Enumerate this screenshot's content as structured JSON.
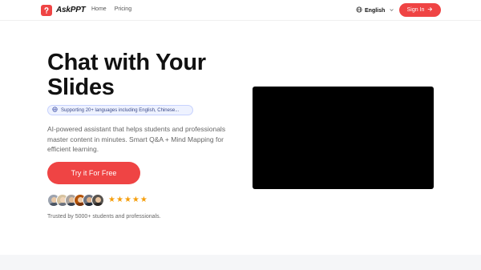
{
  "header": {
    "brand": "AskPPT",
    "nav": [
      {
        "label": "Home"
      },
      {
        "label": "Pricing"
      }
    ],
    "language": "English",
    "signin_label": "Sign In"
  },
  "hero": {
    "title_line1": "Chat with Your",
    "title_line2": "Slides",
    "languages_pill": "Supporting 20+ languages including English, Chinese...",
    "description": "AI-powered assistant that helps students and professionals master content in minutes. Smart Q&A + Mind Mapping for efficient learning.",
    "cta_label": "Try it For Free",
    "rating_stars": 5,
    "trusted_text": "Trusted by 5000+ students and professionals."
  },
  "colors": {
    "accent": "#ef4444",
    "star": "#f59e0b",
    "video_bg": "#000000"
  },
  "icons": {
    "logo": "question-mark-icon",
    "globe": "globe-icon",
    "chevron": "chevron-down-icon",
    "arrow": "arrow-right-icon",
    "star": "star-icon"
  }
}
